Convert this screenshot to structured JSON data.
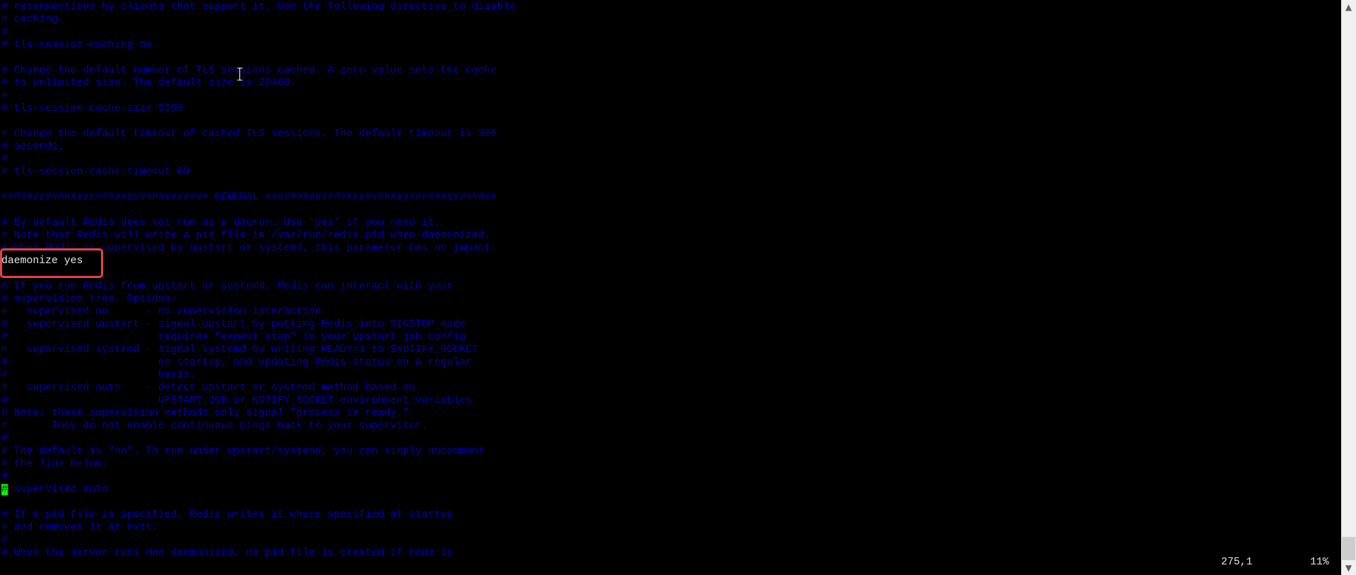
{
  "editor": {
    "lines": [
      "# reconnections by clients that support it. Use the following directive to disable",
      "# caching.",
      "#",
      "# tls-session-caching no",
      "",
      "# Change the default number of TLS sessions cached. A zero value sets the cache",
      "# to unlimited size. The default size is 20480.",
      "#",
      "# tls-session-cache-size 5000",
      "",
      "# Change the default timeout of cached TLS sessions. The default timeout is 300",
      "# seconds.",
      "#",
      "# tls-session-cache-timeout 60",
      "",
      "################################# GENERAL #####################################",
      "",
      "# By default Redis does not run as a daemon. Use 'yes' if you need it.",
      "# Note that Redis will write a pid file in /var/run/redis.pid when daemonized.",
      "# When Redis is supervised by upstart or systemd, this parameter has no impact.",
      "daemonize yes",
      "",
      "# If you run Redis from upstart or systemd, Redis can interact with your",
      "# supervision tree. Options:",
      "#   supervised no      - no supervision interaction",
      "#   supervised upstart - signal upstart by putting Redis into SIGSTOP mode",
      "#                        requires \"expect stop\" in your upstart job config",
      "#   supervised systemd - signal systemd by writing READY=1 to $NOTIFY_SOCKET",
      "#                        on startup, and updating Redis status on a regular",
      "#                        basis.",
      "#   supervised auto    - detect upstart or systemd method based on",
      "#                        UPSTART_JOB or NOTIFY_SOCKET environment variables",
      "# Note: these supervision methods only signal \"process is ready.\"",
      "#       They do not enable continuous pings back to your supervisor.",
      "#",
      "# The default is \"no\". To run under upstart/systemd, you can simply uncomment",
      "# the line below:",
      "#",
      "# supervised auto",
      "",
      "# If a pid file is specified, Redis writes it where specified at startup",
      "# and removes it at exit.",
      "#",
      "# When the server runs non daemonized, no pid file is created if none is"
    ],
    "plain_lines": [
      20
    ],
    "highlighted_line": 20,
    "cursor_line": 38,
    "cursor_char": "#",
    "colors": {
      "comment": "#0000b4",
      "plain": "#e6e6e6",
      "cursor": "#00ff00",
      "highlight_box": "#e8414a",
      "background": "#000000"
    }
  },
  "status": {
    "position": "275,1",
    "percent": "11%"
  },
  "scrollbar": {
    "up_icon": "▲",
    "down_icon": "▼",
    "scroll_fraction": 0.11
  }
}
